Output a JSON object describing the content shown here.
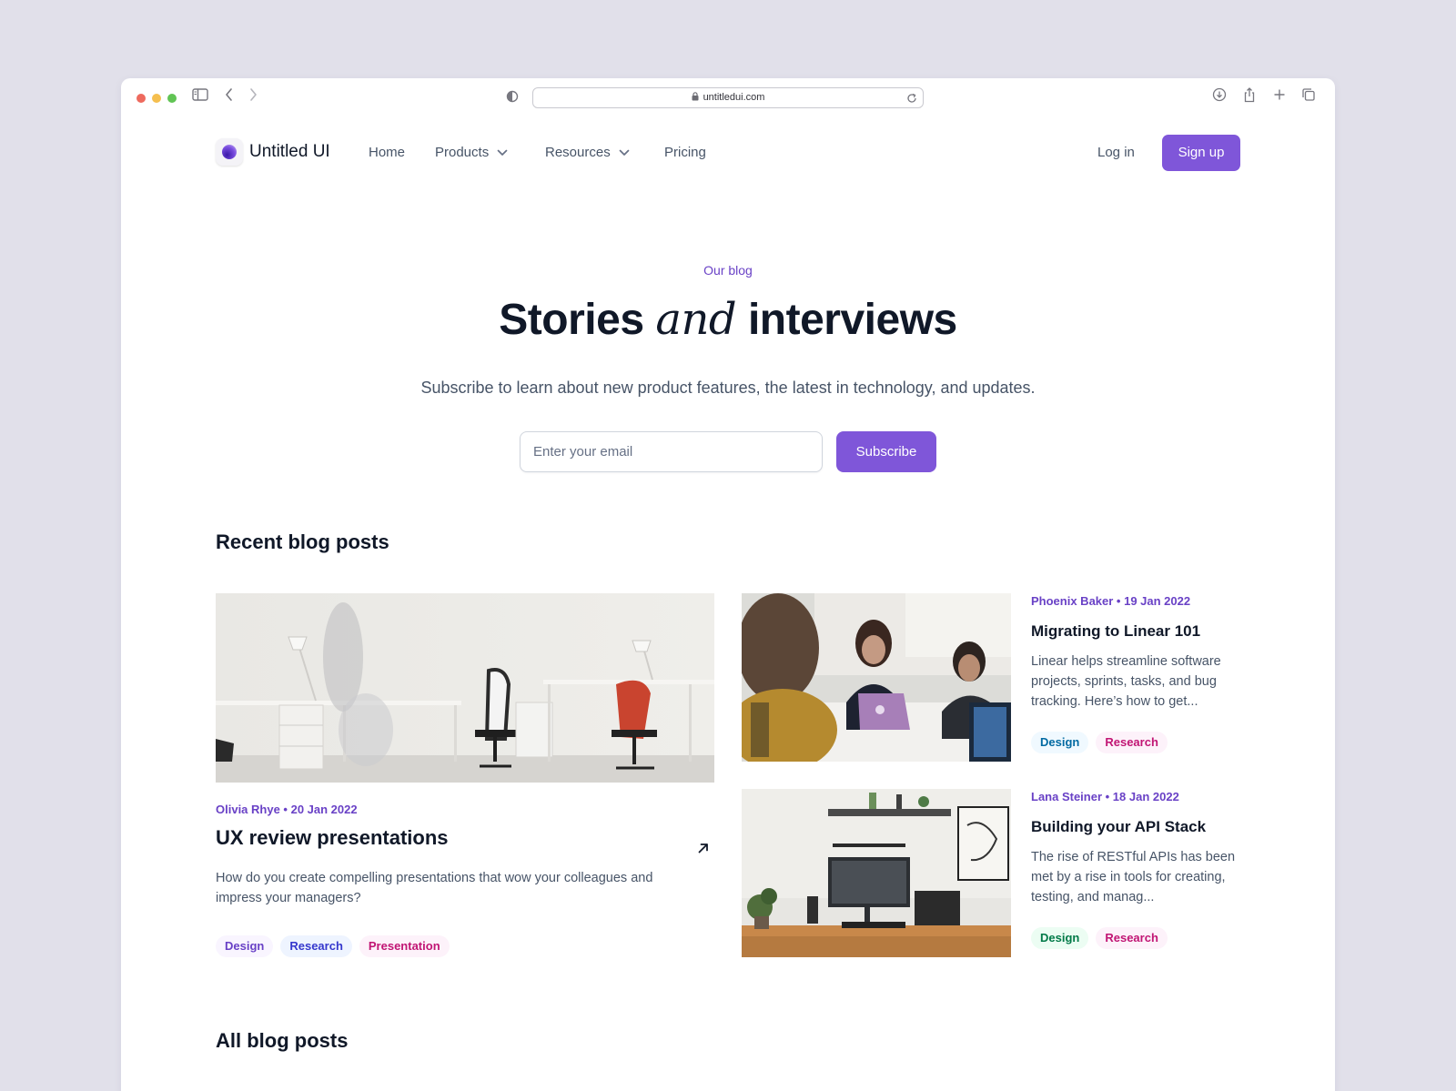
{
  "browser": {
    "url": "untitledui.com"
  },
  "brand": {
    "name": "Untitled UI"
  },
  "nav": {
    "items": [
      {
        "label": "Home",
        "dropdown": false
      },
      {
        "label": "Products",
        "dropdown": true
      },
      {
        "label": "Resources",
        "dropdown": true
      },
      {
        "label": "Pricing",
        "dropdown": false
      }
    ],
    "login": "Log in",
    "signup": "Sign up"
  },
  "hero": {
    "eyebrow": "Our blog",
    "title_part1": "Stories ",
    "title_italic": "and",
    "title_part2": " interviews",
    "subtitle": "Subscribe to learn about new product features, the latest in technology, and updates.",
    "email_placeholder": "Enter your email",
    "subscribe": "Subscribe"
  },
  "recent": {
    "heading": "Recent blog posts",
    "featured": {
      "meta": "Olivia Rhye • 20 Jan 2022",
      "title": "UX review presentations",
      "excerpt": "How do you create compelling presentations that wow your colleagues and impress your managers?",
      "tags": [
        {
          "label": "Design",
          "bg": "#f9f5ff",
          "color": "#6941c6"
        },
        {
          "label": "Research",
          "bg": "#eef4ff",
          "color": "#3538cd"
        },
        {
          "label": "Presentation",
          "bg": "#fdf2fa",
          "color": "#c11574"
        }
      ]
    },
    "posts": [
      {
        "meta": "Phoenix Baker • 19 Jan 2022",
        "title": "Migrating to Linear 101",
        "excerpt": "Linear helps streamline software projects, sprints, tasks, and bug tracking. Here’s how to get...",
        "tags": [
          {
            "label": "Design",
            "bg": "#f0f9ff",
            "color": "#026aa2"
          },
          {
            "label": "Research",
            "bg": "#fdf2fa",
            "color": "#c11574"
          }
        ]
      },
      {
        "meta": "Lana Steiner • 18 Jan 2022",
        "title": "Building your API Stack",
        "excerpt": "The rise of RESTful APIs has been met by a rise in tools for creating, testing, and manag...",
        "tags": [
          {
            "label": "Design",
            "bg": "#ecfdf3",
            "color": "#027a48"
          },
          {
            "label": "Research",
            "bg": "#fdf2fa",
            "color": "#c11574"
          }
        ]
      }
    ]
  },
  "all": {
    "heading": "All blog posts"
  },
  "colors": {
    "accent": "#7f56d9",
    "accent_text": "#6941c6",
    "page_bg": "#e1e0ea"
  }
}
